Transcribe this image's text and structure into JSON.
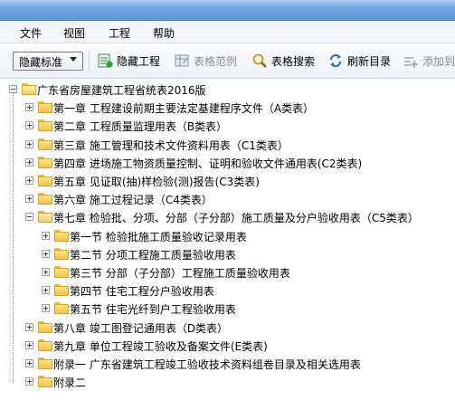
{
  "menu": [
    "文件",
    "视图",
    "工程",
    "帮助"
  ],
  "toolbar": {
    "dropdown_label": "隐藏标准",
    "buttons": [
      {
        "label": "隐藏工程",
        "icon": "hide-project-icon",
        "disabled": false
      },
      {
        "label": "表格范例",
        "icon": "table-sample-icon",
        "disabled": true
      },
      {
        "label": "表格搜索",
        "icon": "search-icon",
        "disabled": false
      },
      {
        "label": "刷新目录",
        "icon": "refresh-icon",
        "disabled": false
      },
      {
        "label": "添加到",
        "icon": "add-icon",
        "disabled": true
      }
    ]
  },
  "tree": {
    "root": "广东省房屋建筑工程省统表2016版",
    "chapters": [
      {
        "label": "第一章  工程建设前期主要法定基建程序文件（A类表）"
      },
      {
        "label": "第二章  工程质量监理用表（B类表）"
      },
      {
        "label": "第三章  施工管理和技术文件资料用表（C1类表）"
      },
      {
        "label": "第四章  进场施工物资质量控制、证明和验收文件通用表(C2类表)"
      },
      {
        "label": "第五章   见证取(抽)样检验(测)报告(C3类表)"
      },
      {
        "label": "第六章  施工过程记录（C4类表）"
      },
      {
        "label": "第七章  检验批、分项、分部（子分部）施工质量及分户验收用表（C5类表）",
        "children": [
          "第一节  检验批施工质量验收记录用表",
          "第二节  分项工程施工质量验收用表",
          "第三节  分部（子分部）工程施工质量验收用表",
          "第四节  住宅工程分户验收用表",
          "第五节  住宅光纤到户工程验收用表"
        ]
      },
      {
        "label": "第八章  竣工图登记通用表（D类表）"
      },
      {
        "label": "第九章  单位工程竣工验收及备案文件(E类表)"
      },
      {
        "label": "附录一  广东省建筑工程竣工验收技术资料组卷目录及相关选用表"
      },
      {
        "label": "附录二"
      }
    ]
  },
  "colors": {
    "folder": "#f2c14a",
    "titlebar": "#5c97d6"
  }
}
